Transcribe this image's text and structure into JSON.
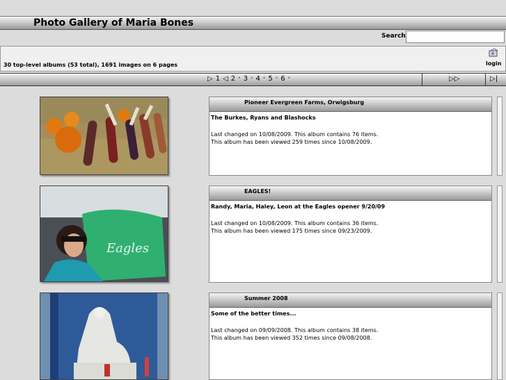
{
  "header": {
    "title": "Photo Gallery of Maria Bones"
  },
  "search": {
    "label": "Search:",
    "value": "",
    "placeholder": ""
  },
  "info": {
    "summary": "30 top-level albums (53 total), 1691 images on 6 pages",
    "login_icon": "login-icon",
    "login_label": "login"
  },
  "pager": {
    "prev_icon": "▷",
    "current": "1",
    "back_icon": "◁",
    "pages": [
      "2",
      "3",
      "4",
      "5",
      "6"
    ],
    "separator": "°",
    "next_icon": "▷▷",
    "last_icon": "▷|"
  },
  "albums": [
    {
      "title": "Pioneer Evergreen Farms, Orwigsburg",
      "description": "The Burkes, Ryans and Blashocks",
      "stats": "Last changed on 10/08/2009. This album contains 76 items.\nThis album has been viewed 259 times since 10/08/2009."
    },
    {
      "title": "EAGLES!",
      "description": "Randy, Maria, Haley, Leon at the Eagles opener 9/20/09",
      "stats": "Last changed on 10/08/2009. This album contains 36 items.\nThis album has been viewed 175 times since 09/23/2009."
    },
    {
      "title": "Summer 2008",
      "description": "Some of the better times...",
      "stats": "Last changed on 09/09/2008. This album contains 38 items.\nThis album has been viewed 352 times since 09/08/2008."
    }
  ]
}
